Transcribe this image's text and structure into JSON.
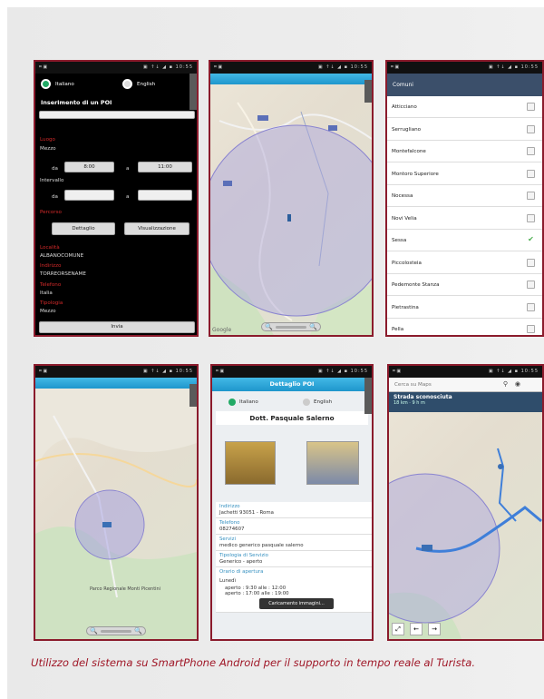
{
  "caption": "Utilizzo del sistema su SmartPhone Android per il supporto in tempo reale al Turista.",
  "status_bar": {
    "left": "⌗ ▣",
    "right": "▣ ↑↓ ◢ ▪ 10:55"
  },
  "screen_search": {
    "radio_options": [
      "Italiano",
      "English"
    ],
    "title": "Inserimento di un POI",
    "section_luogo": "Luogo",
    "label_mezzo": "Mezzo",
    "da_label": "da",
    "a_label": "a",
    "ora_from": "8:00",
    "ora_to": "11:00",
    "label_intervallo": "Intervallo",
    "section_percorso": "Percorso",
    "btn_dettaglio": "Dettaglio",
    "btn_visualizza": "Visualizzazione",
    "info_labels": [
      "Località",
      "Indirizzo",
      "Telefono",
      "Tipologia"
    ],
    "info_values": [
      "ALBANOCOMUNE",
      "TORREORSENAME",
      "Italia",
      "Mezzo"
    ],
    "btn_invia": "Invia"
  },
  "screen_comuni": {
    "header": "Comuni",
    "items": [
      {
        "name": "Atticciano",
        "checked": false
      },
      {
        "name": "Serrugliano",
        "checked": false
      },
      {
        "name": "Montefalcone",
        "checked": false
      },
      {
        "name": "Montoro Superiore",
        "checked": false
      },
      {
        "name": "Nocessa",
        "checked": false
      },
      {
        "name": "Novi Velia",
        "checked": false
      },
      {
        "name": "Sessa",
        "checked": true
      },
      {
        "name": "Piccolosteia",
        "checked": false
      },
      {
        "name": "Pedemonte Stanza",
        "checked": false
      },
      {
        "name": "Pietrastina",
        "checked": false
      },
      {
        "name": "Pella",
        "checked": false
      }
    ]
  },
  "screen_detail": {
    "header": "Dettaglio POI",
    "radio_options": [
      "Italiano",
      "English"
    ],
    "name": "Dott. Pasquale Salerno",
    "fields": [
      {
        "label": "Indirizzo",
        "value": "Jachetti 93051 - Roma"
      },
      {
        "label": "Telefono",
        "value": "08274607"
      },
      {
        "label": "Servizi",
        "value": "medico generico pasquale salerno"
      },
      {
        "label": "Tipologia di Servizio",
        "value": "Generico - aperto"
      }
    ],
    "orari_label": "Orario di apertura",
    "toast": "Caricamento immagini...",
    "orari": [
      "Lunedì",
      "aperto : 9:30 alle : 12:00",
      "aperto : 17:00 alle : 19:00"
    ]
  },
  "screen_route": {
    "search_placeholder": "Cerca su Maps",
    "route_title": "Strada sconosciuta",
    "route_sub": "18 km · 9 h m"
  },
  "map_labels": {
    "park": "Parco Regionale Monti Picentini",
    "google": "Google"
  },
  "colors": {
    "frame": "#8b1b2c",
    "caption": "#a01828",
    "android_blue": "#2aa4d8",
    "check": "#4caf50"
  }
}
